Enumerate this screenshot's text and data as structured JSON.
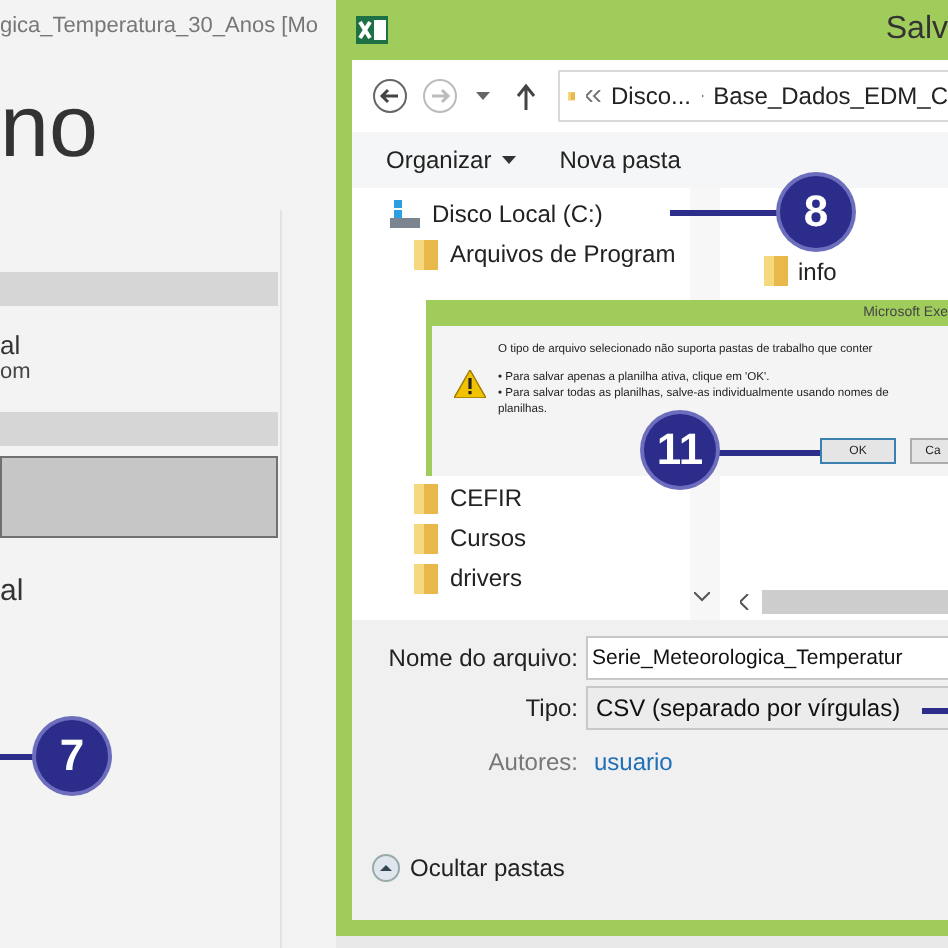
{
  "backstage": {
    "title": "gica_Temperatura_30_Anos  [Mo",
    "heading": "no",
    "sections": [
      {
        "kind": "header"
      },
      {
        "kind": "place",
        "label": "al",
        "detail": "om",
        "selected": false
      },
      {
        "kind": "header"
      },
      {
        "kind": "place",
        "selected": true
      },
      {
        "kind": "place",
        "label": "al",
        "selected": false
      }
    ],
    "callout": "7"
  },
  "save_dialog": {
    "title": "Salv",
    "address": [
      "Disco...",
      "Base_Dados_EDM_C"
    ],
    "toolbar": [
      "Organizar",
      "Nova pasta"
    ],
    "tree": [
      {
        "label": "Disco Local (C:)",
        "kind": "drive",
        "children": [
          {
            "label": "Arquivos de Program",
            "kind": "folder"
          },
          {
            "label": "CEFIR",
            "kind": "folder"
          },
          {
            "label": "Cursos",
            "kind": "folder"
          },
          {
            "label": "drivers",
            "kind": "folder"
          }
        ]
      }
    ],
    "files": [
      {
        "label": "info"
      }
    ],
    "callout": "8",
    "fields": [
      {
        "label": "Nome do arquivo:",
        "value": "Serie_Meteorologica_Temperatur",
        "kind": "input"
      },
      {
        "label": "Tipo:",
        "value": "CSV (separado por vírgulas)",
        "kind": "dropdown"
      },
      {
        "label": "Autores:",
        "value": "usuario",
        "kind": "link"
      }
    ],
    "hide_folders": "Ocultar pastas"
  },
  "message_box": {
    "title": "Microsoft Exe",
    "lines": [
      "O tipo de arquivo selecionado não suporta pastas de trabalho que conter",
      "• Para salvar apenas a planilha ativa, clique em 'OK'.",
      "• Para salvar todas as planilhas, salve-as individualmente usando nomes de",
      "planilhas."
    ],
    "buttons": [
      {
        "label": "OK",
        "selected": true
      },
      {
        "label": "Ca",
        "selected": false
      }
    ],
    "callout": "11"
  }
}
